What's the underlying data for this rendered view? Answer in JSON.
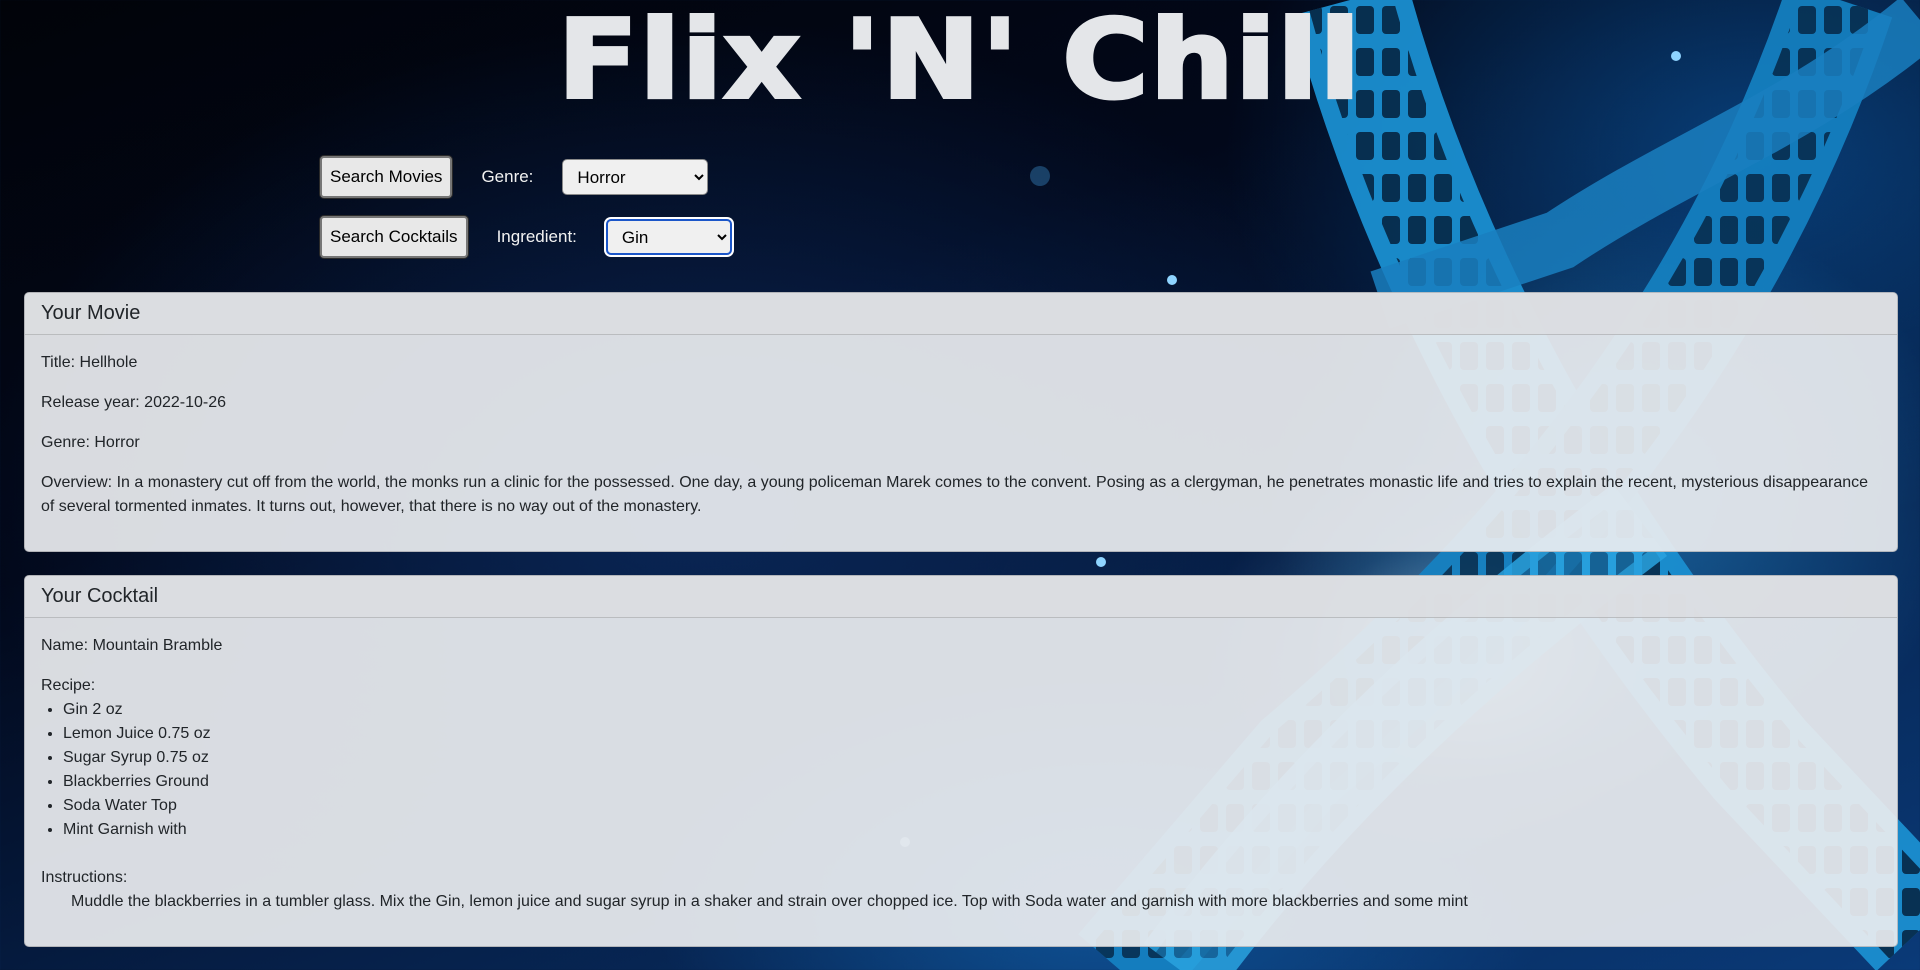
{
  "header": {
    "title": "Flix 'N' Chill"
  },
  "movie_search": {
    "button_label": "Search Movies",
    "genre_label": "Genre:",
    "genre_selected": "Horror"
  },
  "cocktail_search": {
    "button_label": "Search Cocktails",
    "ingredient_label": "Ingredient:",
    "ingredient_selected": "Gin"
  },
  "movie_card": {
    "heading": "Your Movie",
    "title_label": "Title:",
    "title_value": "Hellhole",
    "release_label": "Release year:",
    "release_value": "2022-10-26",
    "genre_label": "Genre:",
    "genre_value": "Horror",
    "overview_label": "Overview:",
    "overview_value": "In a monastery cut off from the world, the monks run a clinic for the possessed. One day, a young policeman Marek comes to the convent. Posing as a clergyman, he penetrates monastic life and tries to explain the recent, mysterious disappearance of several tormented inmates. It turns out, however, that there is no way out of the monastery."
  },
  "cocktail_card": {
    "heading": "Your Cocktail",
    "name_label": "Name:",
    "name_value": "Mountain Bramble",
    "recipe_label": "Recipe:",
    "recipe_items": [
      "Gin 2 oz",
      "Lemon Juice 0.75 oz",
      "Sugar Syrup 0.75 oz",
      "Blackberries Ground",
      "Soda Water Top",
      "Mint Garnish with"
    ],
    "instructions_label": "Instructions:",
    "instructions_value": "Muddle the blackberries in a tumbler glass. Mix the Gin, lemon juice and sugar syrup in a shaker and strain over chopped ice. Top with Soda water and garnish with more blackberries and some mint"
  }
}
